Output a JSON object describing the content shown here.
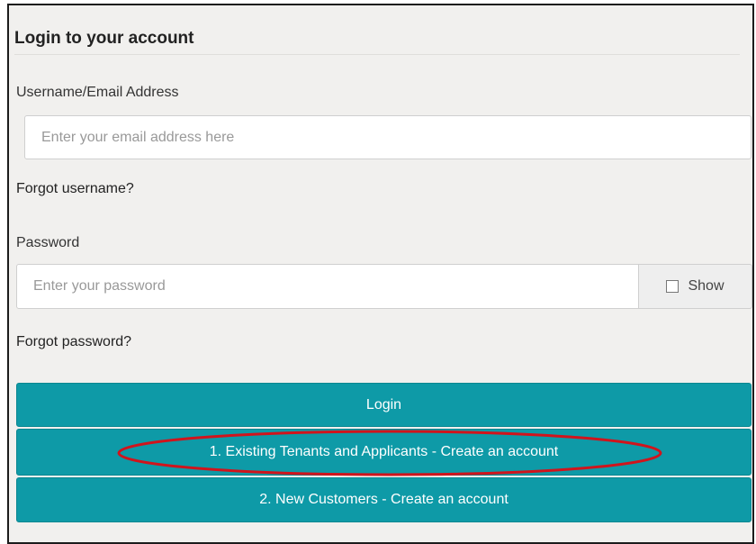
{
  "login_panel": {
    "title": "Login to your account",
    "username": {
      "label": "Username/Email Address",
      "placeholder": "Enter your email address here"
    },
    "forgot_username": "Forgot username?",
    "password": {
      "label": "Password",
      "placeholder": "Enter your password",
      "show_label": "Show",
      "show_checked": false
    },
    "forgot_password": "Forgot password?",
    "buttons": {
      "login": "Login",
      "existing_tenants": "1. Existing Tenants and Applicants - Create an account",
      "new_customers": "2. New Customers - Create an account"
    }
  },
  "colors": {
    "button": "#0e9aa7",
    "panel_background": "#f1f0ee",
    "highlight": "#d0141c"
  }
}
